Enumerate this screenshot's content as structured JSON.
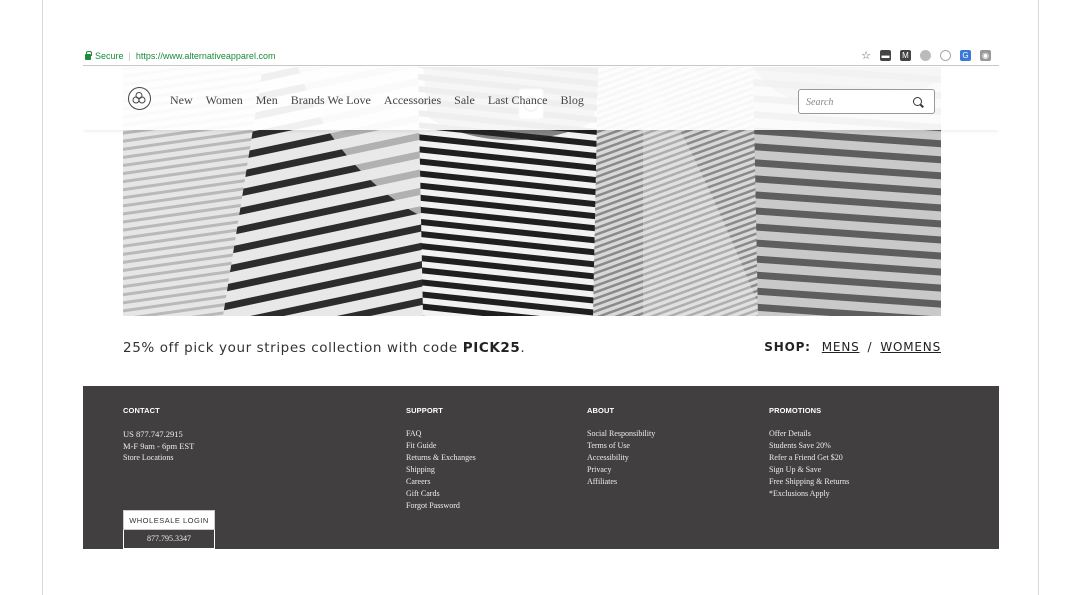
{
  "browser": {
    "secure_label": "Secure",
    "url": "https://www.alternativeapparel.com",
    "extensions": [
      "star-icon",
      "dark-ext-icon",
      "gmail-ext-icon",
      "grey-ext-icon",
      "circle-ext-icon",
      "translate-ext-icon",
      "camera-ext-icon"
    ]
  },
  "header": {
    "nav": [
      "New",
      "Women",
      "Men",
      "Brands We Love",
      "Accessories",
      "Sale",
      "Last Chance",
      "Blog"
    ],
    "search_placeholder": "Search"
  },
  "promo": {
    "text": "25% off pick your stripes collection with code ",
    "code": "PICK25",
    "suffix": ".",
    "shop_label": "SHOP:",
    "mens": "MENS",
    "divider": "/",
    "womens": "WOMENS"
  },
  "footer": {
    "contact": {
      "heading": "CONTACT",
      "phone": "US 877.747.2915",
      "hours": "M-F 9am - 6pm EST",
      "stores": "Store Locations"
    },
    "support": {
      "heading": "SUPPORT",
      "links": [
        "FAQ",
        "Fit Guide",
        "Returns & Exchanges",
        "Shipping",
        "Careers",
        "Gift Cards",
        "Forgot Password"
      ]
    },
    "about": {
      "heading": "ABOUT",
      "links": [
        "Social Responsibility",
        "Terms of Use",
        "Accessibility",
        "Privacy",
        "Affiliates"
      ]
    },
    "promotions": {
      "heading": "PROMOTIONS",
      "links": [
        "Offer Details",
        "Students Save 20%",
        "Refer a Friend Get $20",
        "Sign Up & Save",
        "Free Shipping & Returns",
        "*Exclusions Apply"
      ]
    },
    "wholesale": {
      "button": "WHOLESALE LOGIN",
      "phone": "877.795.3347"
    }
  },
  "colors": {
    "footer_bg": "#413f40",
    "secure_green": "#1a8c3a"
  }
}
